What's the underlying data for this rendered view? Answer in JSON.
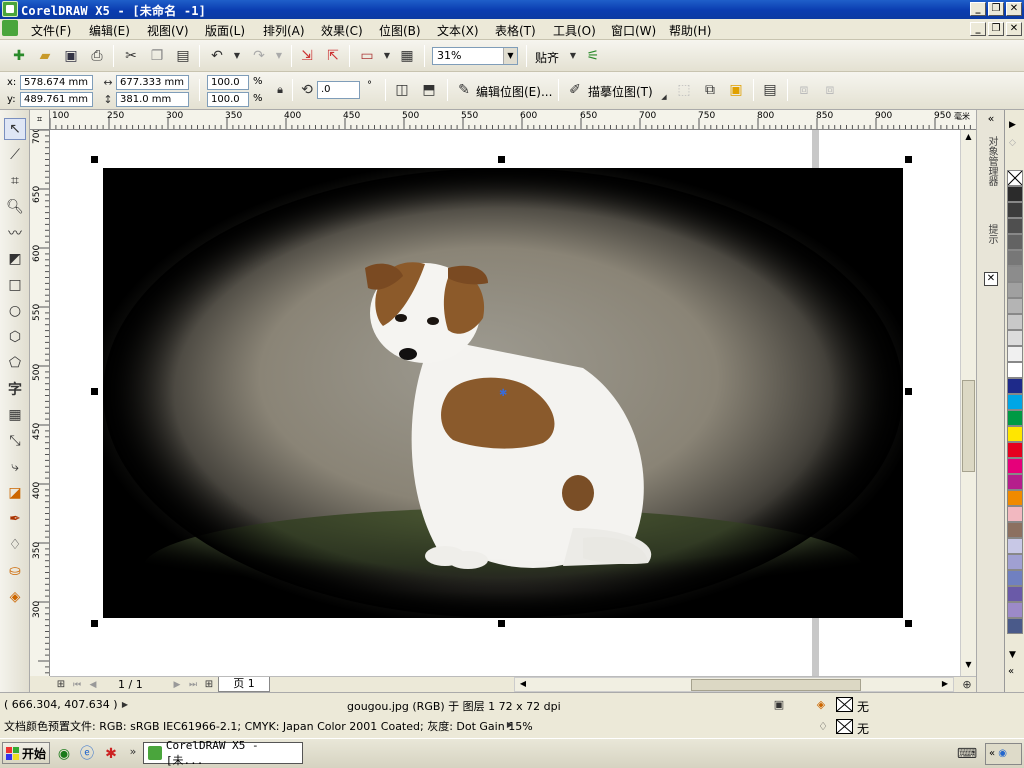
{
  "window": {
    "title": "CorelDRAW X5 - [未命名 -1]"
  },
  "window_buttons": {
    "minimize": "_",
    "restore": "❐",
    "close": "✕"
  },
  "menu": [
    "文件(F)",
    "编辑(E)",
    "视图(V)",
    "版面(L)",
    "排列(A)",
    "效果(C)",
    "位图(B)",
    "文本(X)",
    "表格(T)",
    "工具(O)",
    "窗口(W)",
    "帮助(H)"
  ],
  "standard_toolbar": {
    "zoom": "31%",
    "snap": "贴齐"
  },
  "property_bar": {
    "x_label": "x:",
    "x": "578.674 mm",
    "y_label": "y:",
    "y": "489.761 mm",
    "width": "677.333 mm",
    "height": "381.0 mm",
    "scale_w": "100.0",
    "scale_h": "100.0",
    "percent": "%",
    "rotation": ".0",
    "degree": "°",
    "edit_bitmap": "编辑位图(E)...",
    "trace_bitmap": "描摹位图(T)"
  },
  "rulers": {
    "top_unit": "毫米",
    "top": [
      "100",
      "250",
      "300",
      "350",
      "400",
      "450",
      "500",
      "550",
      "600",
      "650",
      "700",
      "750",
      "800",
      "850",
      "900",
      "950"
    ],
    "left": [
      "700",
      "650",
      "600",
      "550",
      "500",
      "450",
      "400",
      "350",
      "300"
    ]
  },
  "docker": {
    "object_manager": "对象管理器",
    "hints": "提示"
  },
  "palette": [
    "#ffffff",
    "#2b2b2b",
    "#3c3c3c",
    "#4f4f4f",
    "#636363",
    "#777777",
    "#8c8c8c",
    "#a0a0a0",
    "#b4b4b4",
    "#c8c8c8",
    "#dcdcdc",
    "#f0f0f0",
    "#ffffff",
    "#1e2a8a",
    "#00a6e6",
    "#009a44",
    "#ffe600",
    "#e6001e",
    "#e6007a",
    "#b51f8c",
    "#f08a00",
    "#f2b8c0",
    "#8c7060",
    "#c8c8e6",
    "#a0a0d2",
    "#7080c0",
    "#6a5aa8",
    "#9c8ac8",
    "#4a5a8a"
  ],
  "page_nav": {
    "counter": "1 / 1",
    "tab": "页 1"
  },
  "status": {
    "coords": "( 666.304, 407.634 )",
    "object_info": "gougou.jpg (RGB) 于 图层 1 72 x 72 dpi",
    "color_profile": "文档颜色预置文件: RGB: sRGB IEC61966-2.1; CMYK: Japan Color 2001 Coated; 灰度: Dot Gain 15%",
    "fill": "无",
    "outline": "无"
  },
  "taskbar": {
    "start": "开始",
    "task": "CorelDRAW X5 - [未..."
  }
}
